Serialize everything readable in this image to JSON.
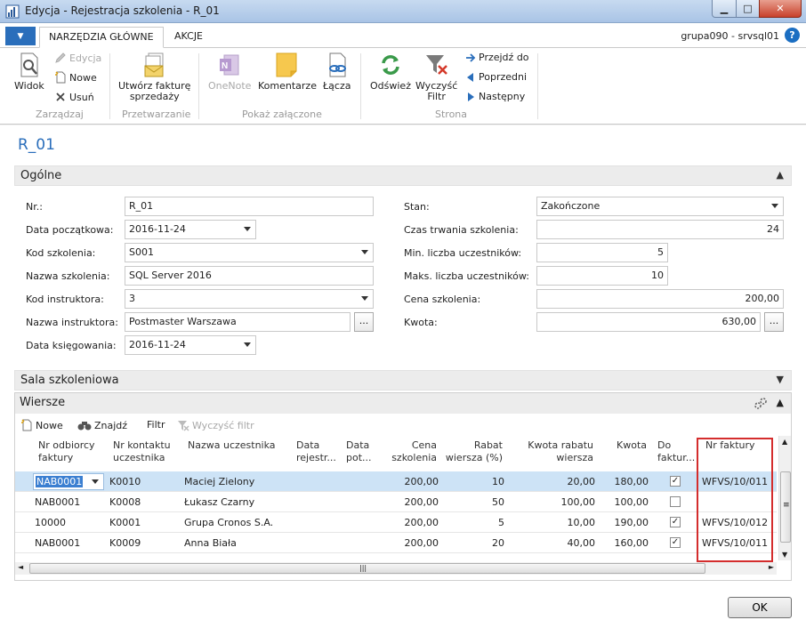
{
  "window": {
    "title": "Edycja - Rejestracja szkolenia - R_01",
    "min": "▁",
    "max": "□",
    "close": "✕"
  },
  "tabs": {
    "file": "▼",
    "home": "NARZĘDZIA GŁÓWNE",
    "actions": "AKCJE",
    "user": "grupa090 - srvsql01",
    "help": "?"
  },
  "ribbon": {
    "groups": {
      "manage": "Zarządzaj",
      "process": "Przetwarzanie",
      "attachments": "Pokaż załączone",
      "page": "Strona"
    },
    "view": "Widok",
    "edit": "Edycja",
    "new": "Nowe",
    "delete": "Usuń",
    "create_invoice_1": "Utwórz fakturę",
    "create_invoice_2": "sprzedaży",
    "onenote": "OneNote",
    "comments": "Komentarze",
    "links": "Łącza",
    "refresh": "Odśwież",
    "clear_filter_1": "Wyczyść",
    "clear_filter_2": "Filtr",
    "goto": "Przejdź do",
    "previous": "Poprzedni",
    "next": "Następny"
  },
  "page": {
    "title": "R_01"
  },
  "general": {
    "section": "Ogólne",
    "collapse": "▲",
    "fields": {
      "nr_label": "Nr.:",
      "nr_value": "R_01",
      "start_label": "Data początkowa:",
      "start_value": "2016-11-24",
      "code_label": "Kod szkolenia:",
      "code_value": "S001",
      "name_label": "Nazwa szkolenia:",
      "name_value": "SQL Server 2016",
      "instr_code_label": "Kod instruktora:",
      "instr_code_value": "3",
      "instr_name_label": "Nazwa instruktora:",
      "instr_name_value": "Postmaster Warszawa",
      "posting_label": "Data księgowania:",
      "posting_value": "2016-11-24",
      "status_label": "Stan:",
      "status_value": "Zakończone",
      "duration_label": "Czas trwania szkolenia:",
      "duration_value": "24",
      "min_label": "Min. liczba uczestników:",
      "min_value": "5",
      "max_label": "Maks. liczba uczestników:",
      "max_value": "10",
      "price_label": "Cena szkolenia:",
      "price_value": "200,00",
      "amount_label": "Kwota:",
      "amount_value": "630,00",
      "assist": "..."
    }
  },
  "room": {
    "section": "Sala szkoleniowa",
    "expand": "▼"
  },
  "lines": {
    "section": "Wiersze",
    "collapse": "▲",
    "toolbar": {
      "new": "Nowe",
      "find": "Znajdź",
      "filter": "Filtr",
      "clear_filter": "Wyczyść filtr"
    },
    "columns": {
      "customer_1": "Nr odbiorcy",
      "customer_2": "faktury",
      "contact_1": "Nr kontaktu",
      "contact_2": "uczestnika",
      "participant": "Nazwa uczestnika",
      "regdate_1": "Data",
      "regdate_2": "rejestr...",
      "date2_1": "Data",
      "date2_2": "pot...",
      "price_1": "Cena",
      "price_2": "szkolenia",
      "discount_1": "Rabat",
      "discount_2": "wiersza (%)",
      "discamt_1": "Kwota rabatu",
      "discamt_2": "wiersza",
      "amount": "Kwota",
      "toinv_1": "Do",
      "toinv_2": "faktur...",
      "invoice": "Nr faktury"
    },
    "rows": [
      {
        "customer": "NAB0001",
        "contact": "K0010",
        "name": "Maciej Zielony",
        "price": "200,00",
        "discount": "10",
        "discamt": "20,00",
        "amount": "180,00",
        "check": "✓",
        "invoice": "WFVS/10/011"
      },
      {
        "customer": "NAB0001",
        "contact": "K0008",
        "name": "Łukasz Czarny",
        "price": "200,00",
        "discount": "50",
        "discamt": "100,00",
        "amount": "100,00",
        "check": "",
        "invoice": ""
      },
      {
        "customer": "10000",
        "contact": "K0001",
        "name": "Grupa Cronos S.A.",
        "price": "200,00",
        "discount": "5",
        "discamt": "10,00",
        "amount": "190,00",
        "check": "✓",
        "invoice": "WFVS/10/012"
      },
      {
        "customer": "NAB0001",
        "contact": "K0009",
        "name": "Anna Biała",
        "price": "200,00",
        "discount": "20",
        "discamt": "40,00",
        "amount": "160,00",
        "check": "✓",
        "invoice": "WFVS/10/011"
      }
    ],
    "scroll": {
      "up": "▲",
      "down": "▼",
      "left": "◄",
      "right": "►",
      "grip": "≡",
      "hgrip": "|||"
    }
  },
  "footer": {
    "ok": "OK"
  }
}
